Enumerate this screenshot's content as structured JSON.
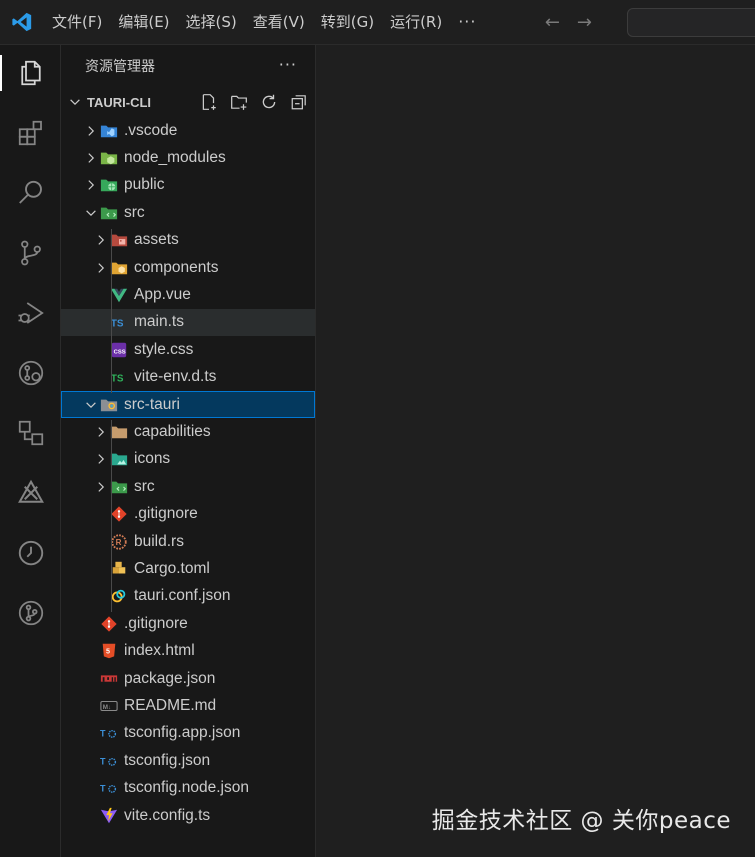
{
  "titlebar": {
    "menu": [
      "文件(F)",
      "编辑(E)",
      "选择(S)",
      "查看(V)",
      "转到(G)",
      "运行(R)"
    ],
    "more": "···",
    "back": "←",
    "forward": "→"
  },
  "activitybar": {
    "items": [
      "explorer",
      "extensions",
      "search",
      "source-control",
      "run-and-debug",
      "remote-explorer",
      "connections",
      "tauri",
      "timeline",
      "git-graph"
    ]
  },
  "sidebar": {
    "title": "资源管理器",
    "more": "···",
    "section_title": "TAURI-CLI"
  },
  "tree": [
    {
      "label": ".vscode",
      "icon": "folder-vscode",
      "type": "folder",
      "expanded": false,
      "depth": 0
    },
    {
      "label": "node_modules",
      "icon": "folder-node",
      "type": "folder",
      "expanded": false,
      "depth": 0
    },
    {
      "label": "public",
      "icon": "folder-public",
      "type": "folder",
      "expanded": false,
      "depth": 0
    },
    {
      "label": "src",
      "icon": "folder-src",
      "type": "folder",
      "expanded": true,
      "depth": 0
    },
    {
      "label": "assets",
      "icon": "folder-assets",
      "type": "folder",
      "expanded": false,
      "depth": 1
    },
    {
      "label": "components",
      "icon": "folder-components",
      "type": "folder",
      "expanded": false,
      "depth": 1
    },
    {
      "label": "App.vue",
      "icon": "vue",
      "type": "file",
      "depth": 1
    },
    {
      "label": "main.ts",
      "icon": "ts",
      "type": "file",
      "depth": 1,
      "hover": true
    },
    {
      "label": "style.css",
      "icon": "css",
      "type": "file",
      "depth": 1
    },
    {
      "label": "vite-env.d.ts",
      "icon": "ts-d",
      "type": "file",
      "depth": 1
    },
    {
      "label": "src-tauri",
      "icon": "folder-tauri",
      "type": "folder",
      "expanded": true,
      "depth": 0,
      "selected": true
    },
    {
      "label": "capabilities",
      "icon": "folder-plain",
      "type": "folder",
      "expanded": false,
      "depth": 1
    },
    {
      "label": "icons",
      "icon": "folder-images",
      "type": "folder",
      "expanded": false,
      "depth": 1
    },
    {
      "label": "src",
      "icon": "folder-src",
      "type": "folder",
      "expanded": false,
      "depth": 1
    },
    {
      "label": ".gitignore",
      "icon": "git",
      "type": "file",
      "depth": 1
    },
    {
      "label": "build.rs",
      "icon": "rust",
      "type": "file",
      "depth": 1
    },
    {
      "label": "Cargo.toml",
      "icon": "cargo",
      "type": "file",
      "depth": 1
    },
    {
      "label": "tauri.conf.json",
      "icon": "tauri",
      "type": "file",
      "depth": 1
    },
    {
      "label": ".gitignore",
      "icon": "git",
      "type": "file",
      "depth": 0
    },
    {
      "label": "index.html",
      "icon": "html",
      "type": "file",
      "depth": 0
    },
    {
      "label": "package.json",
      "icon": "npm",
      "type": "file",
      "depth": 0
    },
    {
      "label": "README.md",
      "icon": "markdown",
      "type": "file",
      "depth": 0
    },
    {
      "label": "tsconfig.app.json",
      "icon": "tsconfig",
      "type": "file",
      "depth": 0
    },
    {
      "label": "tsconfig.json",
      "icon": "tsconfig",
      "type": "file",
      "depth": 0
    },
    {
      "label": "tsconfig.node.json",
      "icon": "tsconfig",
      "type": "file",
      "depth": 0
    },
    {
      "label": "vite.config.ts",
      "icon": "vite",
      "type": "file",
      "depth": 0
    }
  ],
  "watermark": "掘金技术社区 @ 关你peace",
  "colors": {
    "accent": "#0078d4",
    "selection": "#04395e",
    "sidebar_bg": "#181818",
    "editor_bg": "#1f1f1f"
  }
}
